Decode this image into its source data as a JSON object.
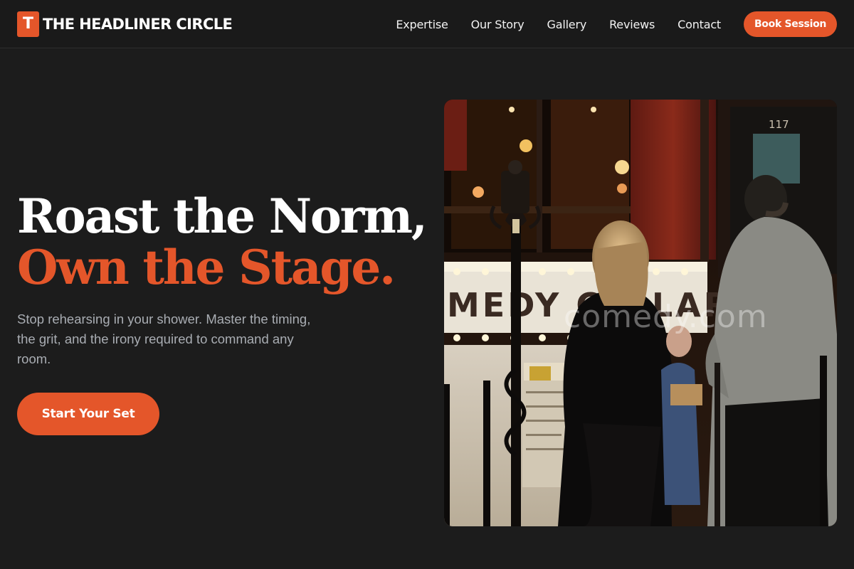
{
  "brand": {
    "mark": "T",
    "name": "THE HEADLINER CIRCLE"
  },
  "nav": {
    "items": [
      {
        "label": "Expertise"
      },
      {
        "label": "Our Story"
      },
      {
        "label": "Gallery"
      },
      {
        "label": "Reviews"
      },
      {
        "label": "Contact"
      }
    ],
    "cta_label": "Book Session"
  },
  "hero": {
    "title_line1": "Roast the Norm,",
    "title_line2": "Own the Stage.",
    "subtitle": "Stop rehearsing in your shower. Master the timing, the grit, and the irony required to command any room.",
    "cta_label": "Start Your Set"
  },
  "photo": {
    "watermark": "comedy.com",
    "marquee_text": "MEDY CELLAR",
    "door_number": "117"
  },
  "colors": {
    "accent": "#e4562a",
    "background": "#1c1c1c",
    "text_primary": "#ffffff",
    "text_muted": "#a9adb3"
  }
}
